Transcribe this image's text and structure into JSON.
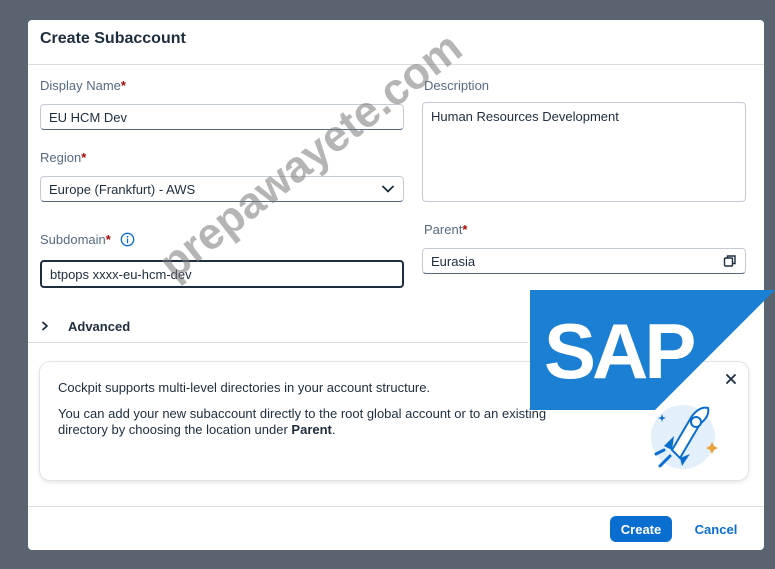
{
  "dialog": {
    "title": "Create Subaccount"
  },
  "form": {
    "display_name": {
      "label": "Display Name",
      "required_mark": "*",
      "value": "EU HCM Dev"
    },
    "description": {
      "label": "Description",
      "value": "Human Resources Development"
    },
    "region": {
      "label": "Region",
      "required_mark": "*",
      "value": "Europe (Frankfurt) - AWS"
    },
    "subdomain": {
      "label": "Subdomain",
      "required_mark": "*",
      "value": "btpops xxxx-eu-hcm-dev"
    },
    "parent": {
      "label": "Parent",
      "required_mark": "*",
      "value": "Eurasia"
    },
    "advanced_label": "Advanced"
  },
  "info_card": {
    "line1": "Cockpit supports multi-level directories in your account structure.",
    "line2_prefix": "You can add your new subaccount directly to the root global account or to an existing directory by choosing the location under ",
    "line2_bold": "Parent",
    "line2_suffix": "."
  },
  "footer": {
    "create_label": "Create",
    "cancel_label": "Cancel"
  },
  "overlay": {
    "logo_text": "SAP",
    "watermark": "prepawayete.com"
  },
  "colors": {
    "accent": "#0a6ed1",
    "required": "#aa0808",
    "text": "#1d2d3e",
    "label": "#556b82",
    "logo_blue": "#1b7fd3"
  },
  "icons": {
    "info": "info-icon",
    "dropdown": "chevron-down-icon",
    "value_help": "value-help-icon",
    "expand": "chevron-right-icon",
    "close": "close-icon",
    "illustration": "rocket-icon"
  }
}
